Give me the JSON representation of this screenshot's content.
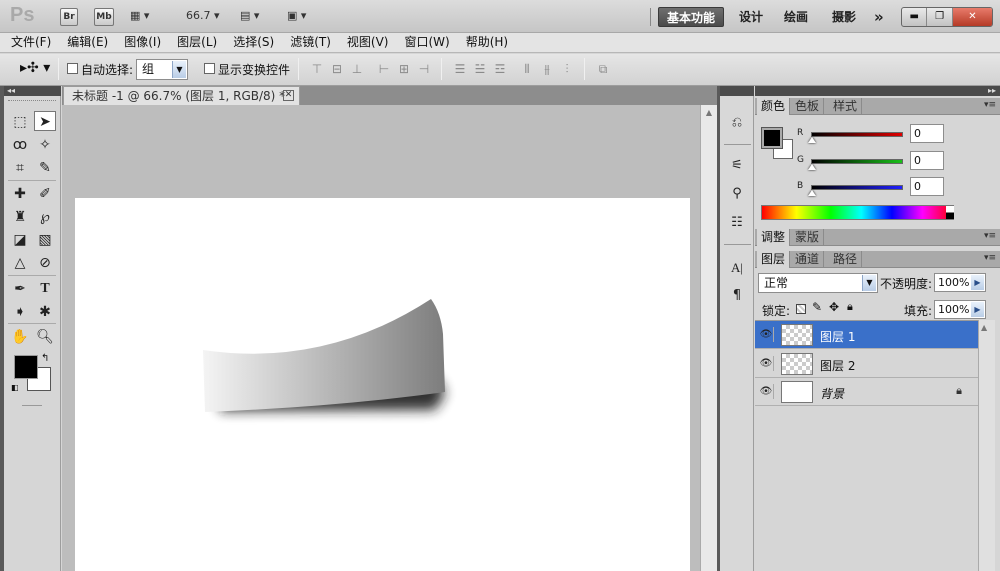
{
  "app": {
    "logo": "Ps",
    "bridge_label": "Br",
    "minibridge_label": "Mb",
    "zoom": "66.7",
    "workspaces": [
      {
        "label": "基本功能",
        "active": true
      },
      {
        "label": "设计",
        "active": false
      },
      {
        "label": "绘画",
        "active": false
      },
      {
        "label": "摄影",
        "active": false
      }
    ],
    "more_workspaces": "»"
  },
  "menubar": {
    "items": [
      "文件(F)",
      "编辑(E)",
      "图像(I)",
      "图层(L)",
      "选择(S)",
      "滤镜(T)",
      "视图(V)",
      "窗口(W)",
      "帮助(H)"
    ]
  },
  "options": {
    "auto_select_label": "自动选择:",
    "auto_select_value": "组",
    "show_transform_label": "显示变换控件"
  },
  "document": {
    "tab_title": "未标题 -1 @ 66.7% (图层 1, RGB/8) *"
  },
  "color_panel": {
    "tabs": [
      {
        "label": "颜色",
        "active": true
      },
      {
        "label": "色板",
        "active": false
      },
      {
        "label": "样式",
        "active": false
      }
    ],
    "channels": [
      {
        "name": "R",
        "value": "0",
        "color": "#d40000"
      },
      {
        "name": "G",
        "value": "0",
        "color": "#19b019"
      },
      {
        "name": "B",
        "value": "0",
        "color": "#1a1aff"
      }
    ]
  },
  "adjust_panel": {
    "tabs": [
      {
        "label": "调整",
        "active": true
      },
      {
        "label": "蒙版",
        "active": false
      }
    ]
  },
  "layers_panel": {
    "tabs": [
      {
        "label": "图层",
        "active": true
      },
      {
        "label": "通道",
        "active": false
      },
      {
        "label": "路径",
        "active": false
      }
    ],
    "blend_mode": "正常",
    "opacity_label": "不透明度:",
    "opacity_value": "100%",
    "lock_label": "锁定:",
    "fill_label": "填充:",
    "fill_value": "100%",
    "layers": [
      {
        "name": "图层 1",
        "selected": true,
        "transparent": true,
        "locked": false
      },
      {
        "name": "图层 2",
        "selected": false,
        "transparent": true,
        "locked": false
      },
      {
        "name": "背景",
        "selected": false,
        "transparent": false,
        "locked": true
      }
    ]
  },
  "colors": {
    "selection": "#3a70c9",
    "foreground": "#000000",
    "background": "#ffffff"
  }
}
